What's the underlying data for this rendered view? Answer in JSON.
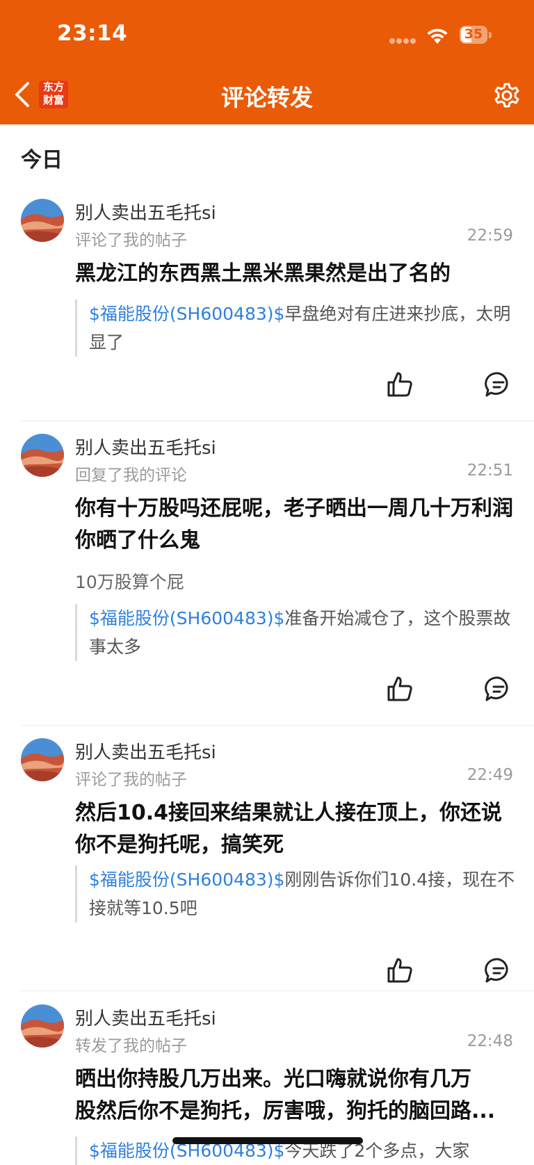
{
  "status_bar": {
    "time": "23:14",
    "battery": "35"
  },
  "nav": {
    "logo_line1": "东方",
    "logo_line2": "财富",
    "title": "评论转发"
  },
  "section": {
    "today": "今日"
  },
  "items": [
    {
      "username": "别人卖出五毛托si",
      "action": "评论了我的帖子",
      "time": "22:59",
      "content": "黑龙江的东西黑土黑米黑果然是出了名的",
      "subtext": "",
      "quote_link": "$福能股份(SH600483)$",
      "quote_text": "早盘绝对有庄进来抄底，太明显了"
    },
    {
      "username": "别人卖出五毛托si",
      "action": "回复了我的评论",
      "time": "22:51",
      "content": "你有十万股吗还屁呢，老子晒出一周几十万利润你晒了什么鬼",
      "subtext": "10万股算个屁",
      "quote_link": "$福能股份(SH600483)$",
      "quote_text": "准备开始减仓了，这个股票故事太多"
    },
    {
      "username": "别人卖出五毛托si",
      "action": "评论了我的帖子",
      "time": "22:49",
      "content": "然后10.4接回来结果就让人接在顶上，你还说你不是狗托呢，搞笑死",
      "subtext": "",
      "quote_link": "$福能股份(SH600483)$",
      "quote_text": "刚刚告诉你们10.4接，现在不接就等10.5吧"
    },
    {
      "username": "别人卖出五毛托si",
      "action": "转发了我的帖子",
      "time": "22:48",
      "content_line1": "晒出你持股几万出来。光口嗨就说你有几万",
      "content_line2": "股然后你不是狗托，厉害哦，狗托的脑回路...",
      "subtext": "",
      "quote_link": "$福能股份(SH600483)$",
      "quote_text": "今天跌了2个多点，大家"
    }
  ]
}
